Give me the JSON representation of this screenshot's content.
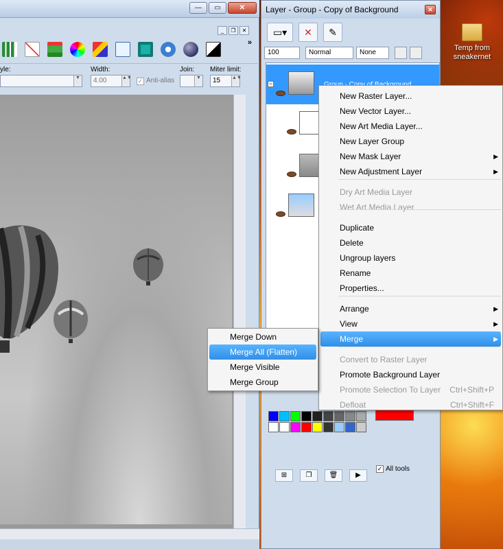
{
  "desktop": {
    "icon_label_line1": "Temp from",
    "icon_label_line2": "sneakernet"
  },
  "main_window": {
    "controls": {
      "minimize": "—",
      "maximize": "▭",
      "close": "✕"
    },
    "toolbar_more": "»",
    "options": {
      "style_label": "yle:",
      "width_label": "Width:",
      "width_value": "4.00",
      "antialias_label": "Anti-alias",
      "join_label": "Join:",
      "miter_label": "Miter limit:",
      "miter_value": "15"
    }
  },
  "layer_palette": {
    "title": "Layer - Group - Copy of Background",
    "opacity_value": "100",
    "blend_mode": "Normal",
    "mask_mode": "None",
    "selected_layer_name": "Group - Copy of Background",
    "all_tools_label": "All tools"
  },
  "context_menu": {
    "items": [
      {
        "label": "New Raster Layer...",
        "disabled": false
      },
      {
        "label": "New Vector Layer...",
        "disabled": false
      },
      {
        "label": "New Art Media Layer...",
        "disabled": false
      },
      {
        "label": "New Layer Group",
        "disabled": false
      },
      {
        "label": "New Mask Layer",
        "disabled": false,
        "submenu": true
      },
      {
        "label": "New Adjustment Layer",
        "disabled": false,
        "submenu": true
      },
      {
        "label": "Dry Art Media Layer",
        "disabled": true
      },
      {
        "label": "Wet Art Media Layer",
        "disabled": true
      },
      {
        "label": "Duplicate",
        "disabled": false
      },
      {
        "label": "Delete",
        "disabled": false
      },
      {
        "label": "Ungroup layers",
        "disabled": false
      },
      {
        "label": "Rename",
        "disabled": false
      },
      {
        "label": "Properties...",
        "disabled": false
      },
      {
        "label": "Arrange",
        "disabled": false,
        "submenu": true
      },
      {
        "label": "View",
        "disabled": false,
        "submenu": true
      },
      {
        "label": "Merge",
        "disabled": false,
        "submenu": true,
        "highlighted": true
      },
      {
        "label": "Convert to Raster Layer",
        "disabled": true
      },
      {
        "label": "Promote Background Layer",
        "disabled": false
      },
      {
        "label": "Promote Selection To Layer",
        "disabled": true,
        "shortcut": "Ctrl+Shift+P"
      },
      {
        "label": "Defloat",
        "disabled": true,
        "shortcut": "Ctrl+Shift+F"
      }
    ],
    "arrow_glyph": "▶"
  },
  "merge_submenu": {
    "items": [
      {
        "label": "Merge Down"
      },
      {
        "label": "Merge All (Flatten)",
        "highlighted": true
      },
      {
        "label": "Merge Visible"
      },
      {
        "label": "Merge Group"
      }
    ]
  },
  "colors": {
    "highlight": "#3399ff",
    "foreground_swatch": "#ff0000"
  }
}
